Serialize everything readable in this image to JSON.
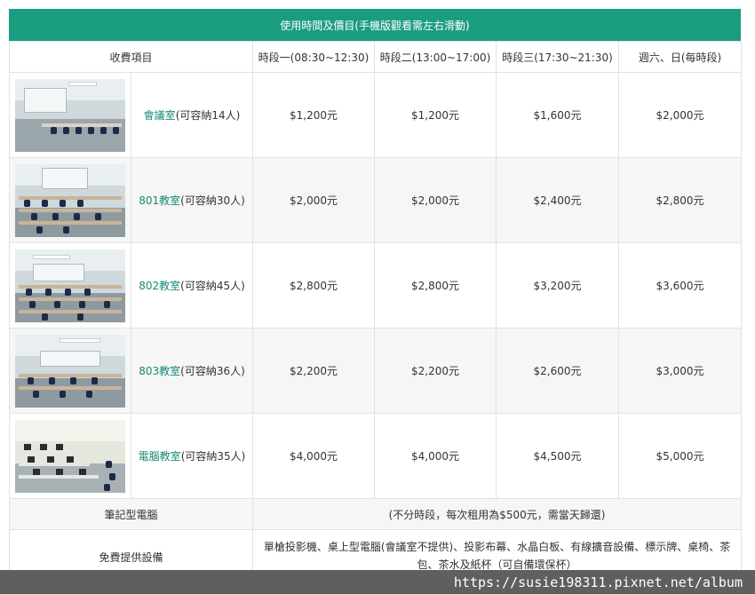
{
  "banner": "使用時間及價目(手機版觀看需左右滑動)",
  "headers": [
    "收費項目",
    "時段一(08:30~12:30)",
    "時段二(13:00~17:00)",
    "時段三(17:30~21:30)",
    "週六、日(每時段)"
  ],
  "rooms": [
    {
      "link": "會議室",
      "cap": "(可容納14人)",
      "prices": [
        "$1,200元",
        "$1,200元",
        "$1,600元",
        "$2,000元"
      ]
    },
    {
      "link": "801教室",
      "cap": "(可容納30人)",
      "prices": [
        "$2,000元",
        "$2,000元",
        "$2,400元",
        "$2,800元"
      ]
    },
    {
      "link": "802教室",
      "cap": "(可容納45人)",
      "prices": [
        "$2,800元",
        "$2,800元",
        "$3,200元",
        "$3,600元"
      ]
    },
    {
      "link": "803教室",
      "cap": "(可容納36人)",
      "prices": [
        "$2,200元",
        "$2,200元",
        "$2,600元",
        "$3,000元"
      ]
    },
    {
      "link": "電腦教室",
      "cap": "(可容納35人)",
      "prices": [
        "$4,000元",
        "$4,000元",
        "$4,500元",
        "$5,000元"
      ]
    }
  ],
  "notebook": {
    "label": "筆記型電腦",
    "text": "(不分時段，每次租用為$500元，需當天歸還)"
  },
  "free": {
    "label": "免費提供設備",
    "text": "單槍投影機、桌上型電腦(會議室不提供)、投影布幕、水晶白板、有線擴音設備、標示牌、桌椅、茶包、茶水及紙杯（可自備環保杯）"
  },
  "watermark": "https://susie198311.pixnet.net/album",
  "colors": {
    "accent": "#1a9c80",
    "link": "#1a8a72",
    "alt_row": "#f6f6f6"
  }
}
